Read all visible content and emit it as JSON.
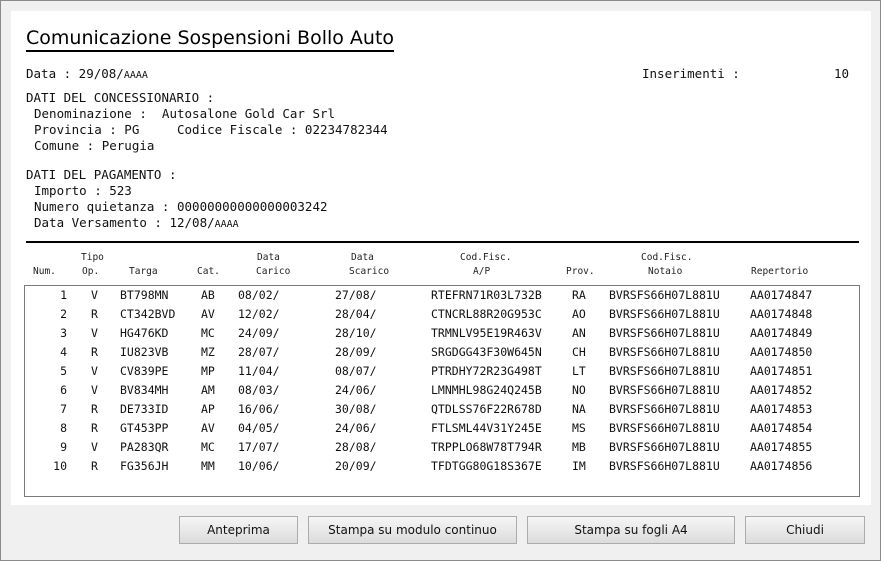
{
  "title": "Comunicazione Sospensioni Bollo Auto",
  "header": {
    "data_label": "Data : 29/08/",
    "data_year": "AAAA",
    "inserimenti_label": "Inserimenti :",
    "inserimenti_value": "10"
  },
  "concessionario": {
    "heading": "DATI DEL CONCESSIONARIO :",
    "denominazione": "Denominazione :  Autosalone Gold Car Srl",
    "provincia_cf": "Provincia : PG     Codice Fiscale : 02234782344",
    "comune": "Comune : Perugia"
  },
  "pagamento": {
    "heading": "DATI DEL PAGAMENTO :",
    "importo": "Importo : 523",
    "quietanza": "Numero quietanza : 00000000000000003242",
    "versamento_label": "Data Versamento : 12/08/",
    "versamento_year": "AAAA"
  },
  "columns": {
    "num": "Num.",
    "tipo1": "Tipo",
    "tipo2": "Op.",
    "targa": "Targa",
    "cat": "Cat.",
    "carico1": "Data",
    "carico2": "Carico",
    "scarico1": "Data",
    "scarico2": "Scarico",
    "cfap1": "Cod.Fisc.",
    "cfap2": "A/P",
    "prov": "Prov.",
    "cfnot1": "Cod.Fisc.",
    "cfnot2": "Notaio",
    "repertorio": "Repertorio"
  },
  "rows": [
    {
      "num": "1",
      "op": "V",
      "targa": "BT798MN",
      "cat": "AB",
      "carico": "08/02/",
      "scarico": "27/08/",
      "cfap": "RTEFRN71R03L732B",
      "prov": "RA",
      "cfnot": "BVRSFS66H07L881U",
      "rep": "AA0174847"
    },
    {
      "num": "2",
      "op": "R",
      "targa": "CT342BVD",
      "cat": "AV",
      "carico": "12/02/",
      "scarico": "28/04/",
      "cfap": "CTNCRL88R20G953C",
      "prov": "AO",
      "cfnot": "BVRSFS66H07L881U",
      "rep": "AA0174848"
    },
    {
      "num": "3",
      "op": "V",
      "targa": "HG476KD",
      "cat": "MC",
      "carico": "24/09/",
      "scarico": "28/10/",
      "cfap": "TRMNLV95E19R463V",
      "prov": "AN",
      "cfnot": "BVRSFS66H07L881U",
      "rep": "AA0174849"
    },
    {
      "num": "4",
      "op": "R",
      "targa": "IU823VB",
      "cat": "MZ",
      "carico": "28/07/",
      "scarico": "28/09/",
      "cfap": "SRGDGG43F30W645N",
      "prov": "CH",
      "cfnot": "BVRSFS66H07L881U",
      "rep": "AA0174850"
    },
    {
      "num": "5",
      "op": "V",
      "targa": "CV839PE",
      "cat": "MP",
      "carico": "11/04/",
      "scarico": "08/07/",
      "cfap": "PTRDHY72R23G498T",
      "prov": "LT",
      "cfnot": "BVRSFS66H07L881U",
      "rep": "AA0174851"
    },
    {
      "num": "6",
      "op": "V",
      "targa": "BV834MH",
      "cat": "AM",
      "carico": "08/03/",
      "scarico": "24/06/",
      "cfap": "LMNMHL98G24Q245B",
      "prov": "NO",
      "cfnot": "BVRSFS66H07L881U",
      "rep": "AA0174852"
    },
    {
      "num": "7",
      "op": "R",
      "targa": "DE733ID",
      "cat": "AP",
      "carico": "16/06/",
      "scarico": "30/08/",
      "cfap": "QTDLSS76F22R678D",
      "prov": "NA",
      "cfnot": "BVRSFS66H07L881U",
      "rep": "AA0174853"
    },
    {
      "num": "8",
      "op": "R",
      "targa": "GT453PP",
      "cat": "AV",
      "carico": "04/05/",
      "scarico": "24/06/",
      "cfap": "FTLSML44V31Y245E",
      "prov": "MS",
      "cfnot": "BVRSFS66H07L881U",
      "rep": "AA0174854"
    },
    {
      "num": "9",
      "op": "V",
      "targa": "PA283QR",
      "cat": "MC",
      "carico": "17/07/",
      "scarico": "28/08/",
      "cfap": "TRPPLO68W78T794R",
      "prov": "MB",
      "cfnot": "BVRSFS66H07L881U",
      "rep": "AA0174855"
    },
    {
      "num": "10",
      "op": "R",
      "targa": "FG356JH",
      "cat": "MM",
      "carico": "10/06/",
      "scarico": "20/09/",
      "cfap": "TFDTGG80G18S367E",
      "prov": "IM",
      "cfnot": "BVRSFS66H07L881U",
      "rep": "AA0174856"
    }
  ],
  "buttons": {
    "anteprima": "Anteprima",
    "stampa_continuo": "Stampa su modulo continuo",
    "stampa_a4": "Stampa su fogli A4",
    "chiudi": "Chiudi"
  }
}
